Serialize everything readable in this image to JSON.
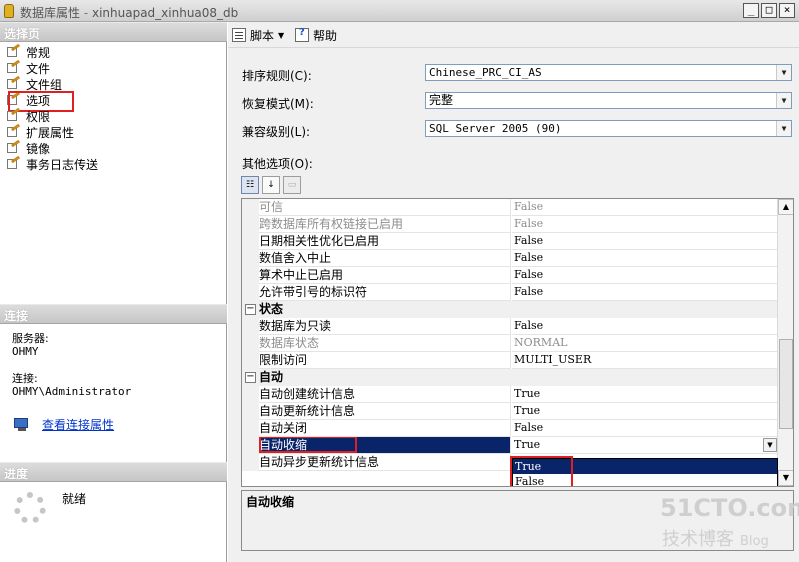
{
  "window": {
    "title": "数据库属性",
    "title_sep": " - ",
    "db_name": "xinhuapad_xinhua08_db",
    "controls": [
      "_",
      "□",
      "×"
    ]
  },
  "left": {
    "select_page_header": "选择页",
    "nav_items": [
      "常规",
      "文件",
      "文件组",
      "选项",
      "权限",
      "扩展属性",
      "镜像",
      "事务日志传送"
    ],
    "active_item": "选项",
    "connection_header": "连接",
    "server_label": "服务器:",
    "server_value": "OHMY",
    "connection_label": "连接:",
    "connection_value": "OHMY\\Administrator",
    "view_connection_link": "查看连接属性",
    "progress_header": "进度",
    "progress_status": "就绪"
  },
  "toolbar": {
    "script_label": "脚本",
    "help_label": "帮助"
  },
  "form": {
    "collation_label": "排序规则(C):",
    "collation_value": "Chinese_PRC_CI_AS",
    "recovery_label": "恢复模式(M):",
    "recovery_value": "完整",
    "compat_label": "兼容级别(L):",
    "compat_value": "SQL Server 2005 (90)",
    "other_label": "其他选项(O):"
  },
  "grid": {
    "rows": [
      {
        "name": "可信",
        "value": "False",
        "dim": true
      },
      {
        "name": "跨数据库所有权链接已启用",
        "value": "False",
        "dim": true
      },
      {
        "name": "日期相关性优化已启用",
        "value": "False"
      },
      {
        "name": "数值舍入中止",
        "value": "False"
      },
      {
        "name": "算术中止已启用",
        "value": "False"
      },
      {
        "name": "允许带引号的标识符",
        "value": "False"
      },
      {
        "name": "状态",
        "category": true
      },
      {
        "name": "数据库为只读",
        "value": "False"
      },
      {
        "name": "数据库状态",
        "value": "NORMAL",
        "dim": true
      },
      {
        "name": "限制访问",
        "value": "MULTI_USER"
      },
      {
        "name": "自动",
        "category": true
      },
      {
        "name": "自动创建统计信息",
        "value": "True"
      },
      {
        "name": "自动更新统计信息",
        "value": "True"
      },
      {
        "name": "自动关闭",
        "value": "False"
      },
      {
        "name": "自动收缩",
        "value": "True",
        "selected": true
      },
      {
        "name": "自动异步更新统计信息",
        "value": ""
      }
    ],
    "dropdown_options": [
      "True",
      "False"
    ],
    "dropdown_highlight": "True"
  },
  "description": {
    "title": "自动收缩"
  },
  "watermark": {
    "site": "51CTO.com",
    "line": "技术博客",
    "blog": "Blog"
  },
  "colors": {
    "selection": "#0a246a",
    "highlight_box": "#e02020",
    "link": "#0033cc"
  }
}
